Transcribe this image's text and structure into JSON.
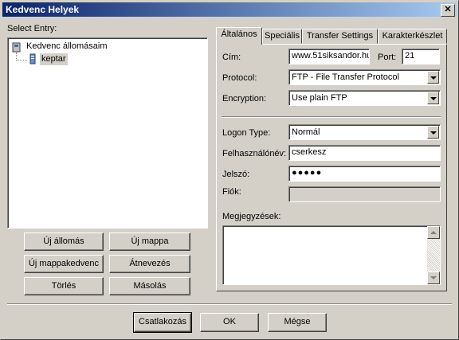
{
  "window": {
    "title": "Kedvenc Helyek",
    "close_glyph": "✕"
  },
  "left": {
    "select_entry_label": "Select Entry:",
    "tree": {
      "root_label": "Kedvenc állomásaim",
      "child_label": "keptar"
    },
    "buttons": {
      "new_site": "Új állomás",
      "new_folder": "Új mappa",
      "new_bookmark": "Új mappakedvenc",
      "rename": "Átnevezés",
      "delete": "Törlés",
      "copy": "Másolás"
    }
  },
  "tabs": [
    {
      "label": "Általános",
      "active": true
    },
    {
      "label": "Speciális",
      "active": false
    },
    {
      "label": "Transfer Settings",
      "active": false
    },
    {
      "label": "Karakterkészlet",
      "active": false
    }
  ],
  "form": {
    "host_label": "Cím:",
    "host_value": "www.51siksandor.hu",
    "port_label": "Port:",
    "port_value": "21",
    "protocol_label": "Protocol:",
    "protocol_value": "FTP - File Transfer Protocol",
    "encryption_label": "Encryption:",
    "encryption_value": "Use plain FTP",
    "logon_type_label": "Logon Type:",
    "logon_type_value": "Normál",
    "user_label": "Felhasználónév:",
    "user_value": "cserkesz",
    "password_label": "Jelszó:",
    "password_value": "●●●●●",
    "account_label": "Fiók:",
    "account_value": "",
    "comments_label": "Megjegyzések:"
  },
  "bottom": {
    "connect": "Csatlakozás",
    "ok": "OK",
    "cancel": "Mégse"
  }
}
